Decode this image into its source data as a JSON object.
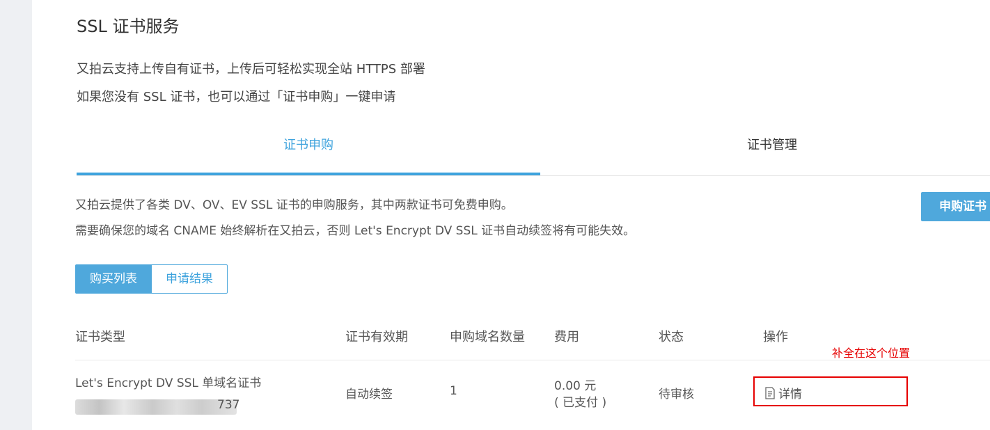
{
  "page": {
    "title": "SSL 证书服务",
    "intro": [
      "又拍云支持上传自有证书，上传后可轻松实现全站 HTTPS 部署",
      "如果您没有 SSL 证书，也可以通过「证书申购」一键申请"
    ]
  },
  "tabs": {
    "purchase": "证书申购",
    "manage": "证书管理"
  },
  "description": [
    "又拍云提供了各类 DV、OV、EV SSL 证书的申购服务，其中两款证书可免费申购。",
    "需要确保您的域名 CNAME 始终解析在又拍云，否则 Let's Encrypt DV SSL 证书自动续签将有可能失效。"
  ],
  "buttons": {
    "purchase_cert": "申购证书"
  },
  "segmented": {
    "purchase_list": "购买列表",
    "apply_result": "申请结果"
  },
  "table": {
    "headers": {
      "type": "证书类型",
      "validity": "证书有效期",
      "domain_count": "申购域名数量",
      "fee": "费用",
      "status": "状态",
      "ops": "操作"
    },
    "rows": [
      {
        "type": "Let's Encrypt DV SSL 单域名证书",
        "id_suffix": "737",
        "validity": "自动续签",
        "domain_count": "1",
        "fee": "0.00 元",
        "fee_note": "( 已支付 )",
        "status": "待审核",
        "action": "详情"
      }
    ]
  },
  "annotation": {
    "text": "补全在这个位置",
    "color": "#e60000"
  },
  "colors": {
    "accent": "#3ea3dd",
    "button": "#4fa8dc",
    "sidebar": "#eef0f3"
  },
  "icons": {
    "detail": "document-icon"
  }
}
